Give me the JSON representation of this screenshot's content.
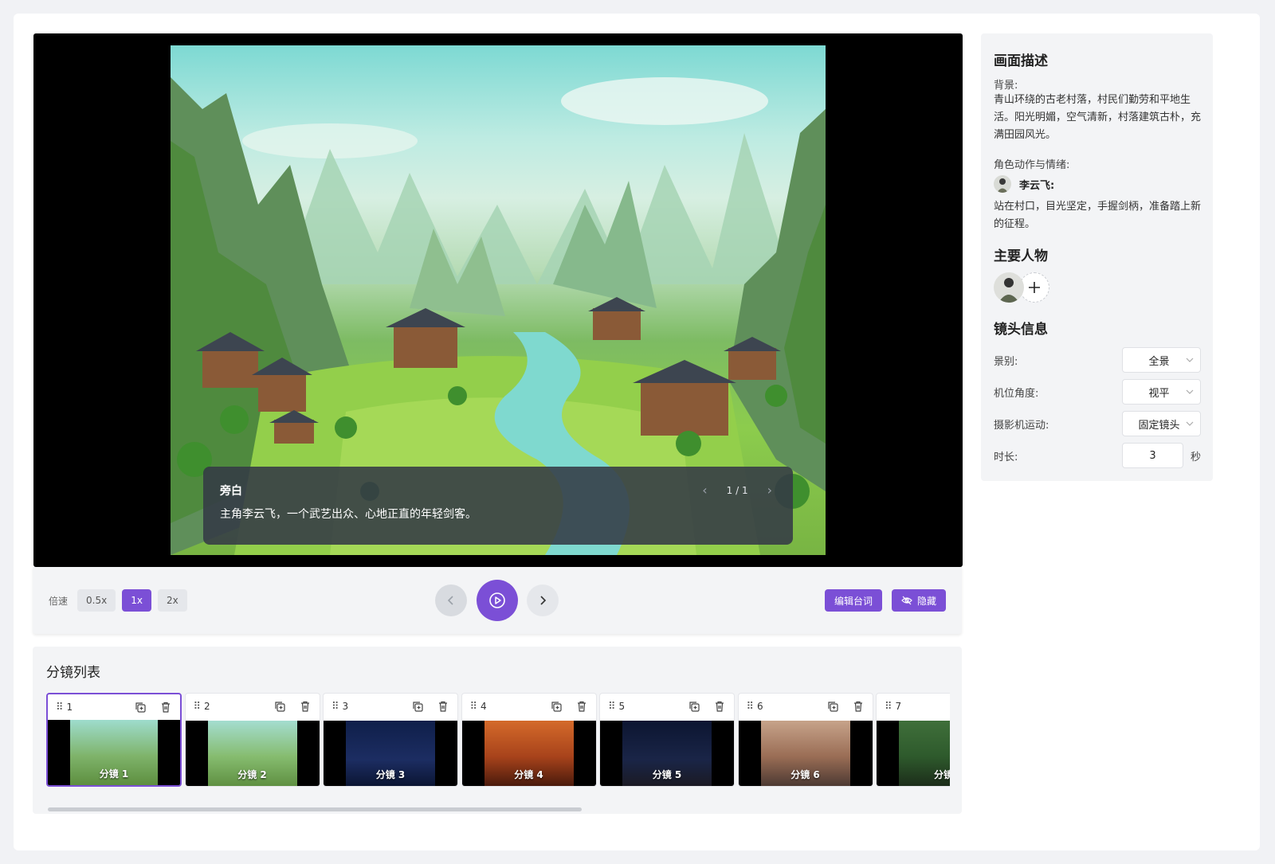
{
  "player": {
    "caption_speaker": "旁白",
    "caption_text": "主角李云飞，一个武艺出众、心地正直的年轻剑客。",
    "caption_page": "1 / 1"
  },
  "controls": {
    "speed_label": "倍速",
    "speeds": [
      "0.5x",
      "1x",
      "2x"
    ],
    "selected_speed": "1x",
    "edit_lines_label": "编辑台词",
    "hide_label": "隐藏"
  },
  "storyboard": {
    "title": "分镜列表",
    "shots": [
      {
        "num": "1",
        "label": "分镜 1",
        "active": true
      },
      {
        "num": "2",
        "label": "分镜 2"
      },
      {
        "num": "3",
        "label": "分镜 3"
      },
      {
        "num": "4",
        "label": "分镜 4"
      },
      {
        "num": "5",
        "label": "分镜 5"
      },
      {
        "num": "6",
        "label": "分镜 6"
      },
      {
        "num": "7",
        "label": "分镜"
      }
    ]
  },
  "panel": {
    "desc_title": "画面描述",
    "bg_label": "背景:",
    "bg_text": "青山环绕的古老村落，村民们勤劳和平地生活。阳光明媚，空气清新，村落建筑古朴，充满田园风光。",
    "action_label": "角色动作与情绪:",
    "character_name": "李云飞:",
    "character_action": "站在村口，目光坚定，手握剑柄，准备踏上新的征程。",
    "roles_title": "主要人物",
    "shot_title": "镜头信息",
    "fields": {
      "scale_label": "景别:",
      "scale_value": "全景",
      "angle_label": "机位角度:",
      "angle_value": "视平",
      "movement_label": "摄影机运动:",
      "movement_value": "固定镜头",
      "duration_label": "时长:",
      "duration_value": "3",
      "duration_unit": "秒"
    }
  },
  "colors": {
    "accent": "#7b4fd6",
    "panel_bg": "#f3f4f6",
    "page_bg": "#f1f2f5"
  },
  "icons": {
    "grip": "drag-grip-icon",
    "copy": "duplicate-icon",
    "delete": "trash-icon",
    "play": "play-circle-icon",
    "prev": "chevron-left-icon",
    "next": "chevron-right-icon",
    "hide": "eye-off-icon",
    "add": "plus-icon"
  }
}
